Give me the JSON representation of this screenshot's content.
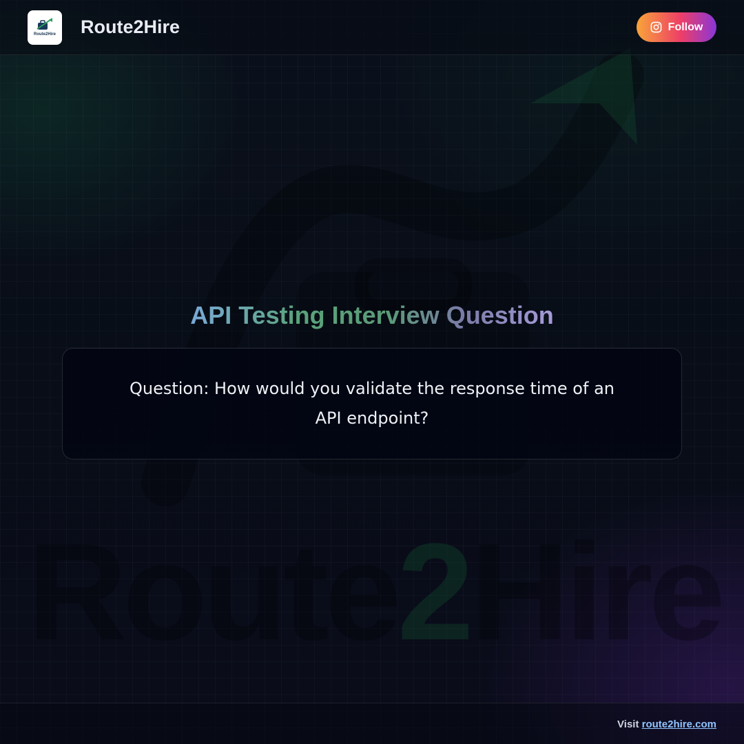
{
  "header": {
    "brand_name": "Route2Hire",
    "logo_text": "Route2Hire",
    "follow_label": "Follow",
    "follow_icon": "instagram-icon"
  },
  "main": {
    "title": "API Testing Interview Question",
    "question": "Question: How would you validate the response time of an API endpoint?"
  },
  "watermark": {
    "part1": "Route",
    "part2": "2",
    "part3": "Hire"
  },
  "footer": {
    "visit_label": "Visit",
    "link_text": "route2hire.com"
  },
  "colors": {
    "background": "#0a0f1a",
    "accent_link": "#8fc4ff",
    "follow_gradient_start": "#f7a43a",
    "follow_gradient_mid": "#ee3f67",
    "follow_gradient_end": "#8a36d8"
  }
}
